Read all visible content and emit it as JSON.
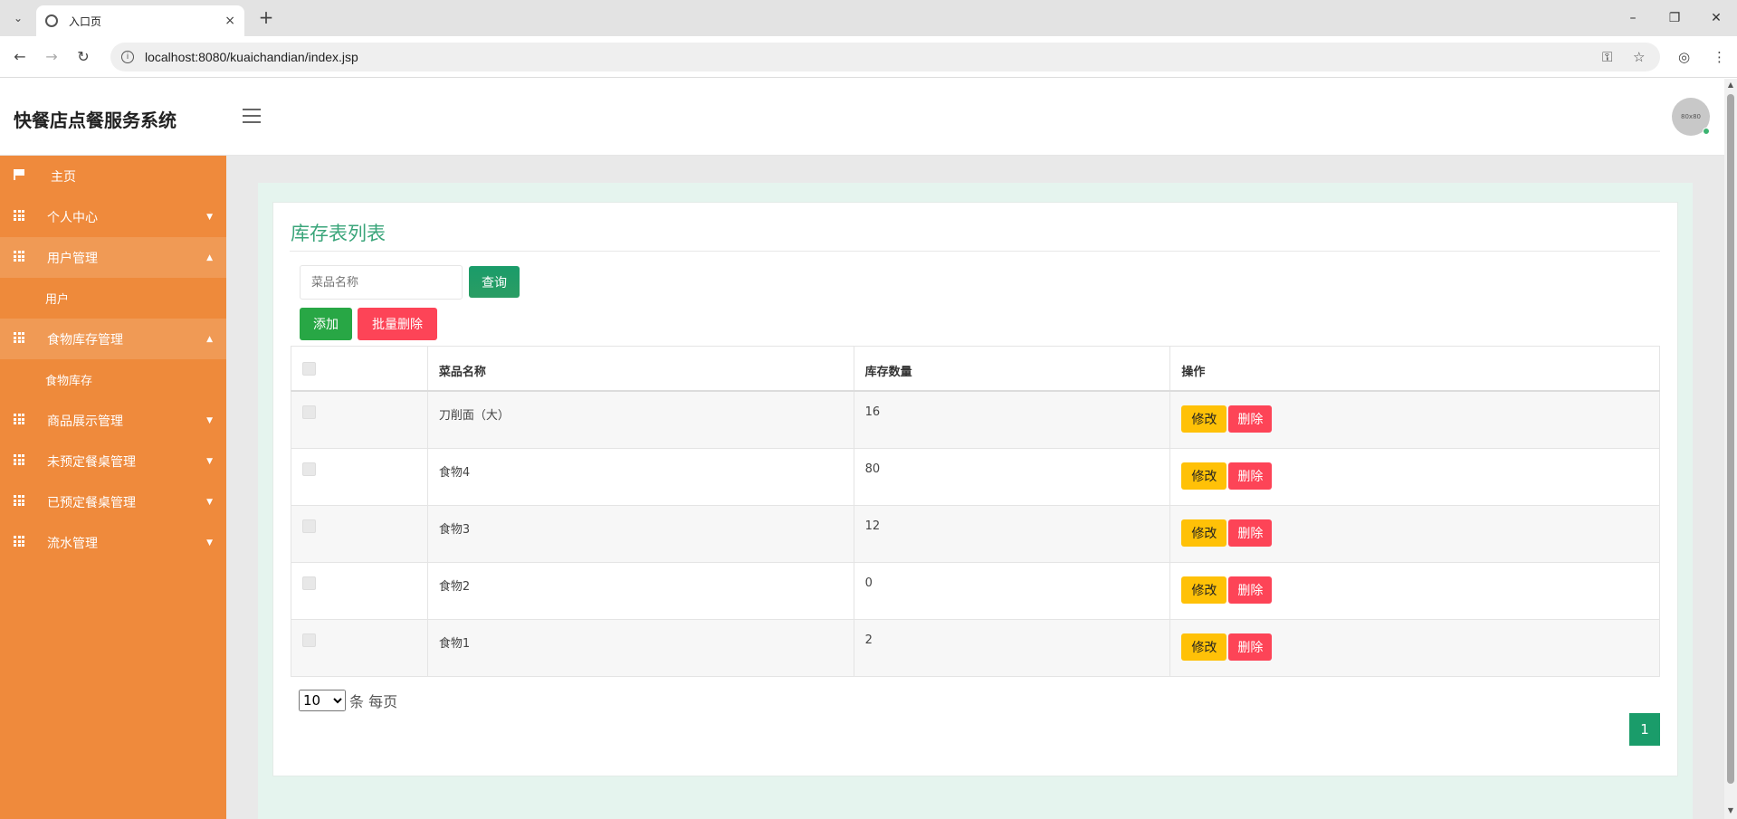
{
  "browser": {
    "tab_title": "入口页",
    "tab_close": "×",
    "new_tab": "+",
    "url": "localhost:8080/kuaichandian/index.jsp",
    "controls": {
      "minimize": "–",
      "restore": "❐",
      "close": "✕"
    },
    "nav": {
      "back": "←",
      "forward": "→",
      "reload": "↻"
    },
    "omni_icons": {
      "key": "⚿",
      "star": "☆",
      "profile": "◎",
      "menu": "⋮"
    }
  },
  "header": {
    "brand": "快餐店点餐服务系统",
    "avatar_text": "80x80"
  },
  "sidebar": {
    "items": [
      {
        "label": "主页",
        "icon": "flag-icon",
        "open": false,
        "children": []
      },
      {
        "label": "个人中心",
        "icon": "grid-icon",
        "open": false,
        "children": []
      },
      {
        "label": "用户管理",
        "icon": "grid-icon",
        "open": true,
        "children": [
          "用户"
        ]
      },
      {
        "label": "食物库存管理",
        "icon": "grid-icon",
        "open": true,
        "children": [
          "食物库存"
        ]
      },
      {
        "label": "商品展示管理",
        "icon": "grid-icon",
        "open": false,
        "children": []
      },
      {
        "label": "未预定餐桌管理",
        "icon": "grid-icon",
        "open": false,
        "children": []
      },
      {
        "label": "已预定餐桌管理",
        "icon": "grid-icon",
        "open": false,
        "children": []
      },
      {
        "label": "流水管理",
        "icon": "grid-icon",
        "open": false,
        "children": []
      }
    ]
  },
  "main": {
    "title": "库存表列表",
    "search": {
      "placeholder": "菜品名称",
      "button": "查询"
    },
    "actions": {
      "add": "添加",
      "bulk_delete": "批量删除"
    },
    "table": {
      "headers": [
        "",
        "菜品名称",
        "库存数量",
        "操作"
      ],
      "rows": [
        {
          "name": "刀削面（大）",
          "qty": "16"
        },
        {
          "name": "食物4",
          "qty": "80"
        },
        {
          "name": "食物3",
          "qty": "12"
        },
        {
          "name": "食物2",
          "qty": "0"
        },
        {
          "name": "食物1",
          "qty": "2"
        }
      ],
      "edit_label": "修改",
      "delete_label": "删除"
    },
    "pagination": {
      "page_size": "10",
      "page_size_options": [
        "10"
      ],
      "suffix": "条 每页",
      "current_page": "1"
    }
  },
  "colors": {
    "sidebar": "#ef8a3c",
    "accent_green": "#3aa57a",
    "edit_yellow": "#ffc107",
    "delete_red": "#fd4457"
  }
}
